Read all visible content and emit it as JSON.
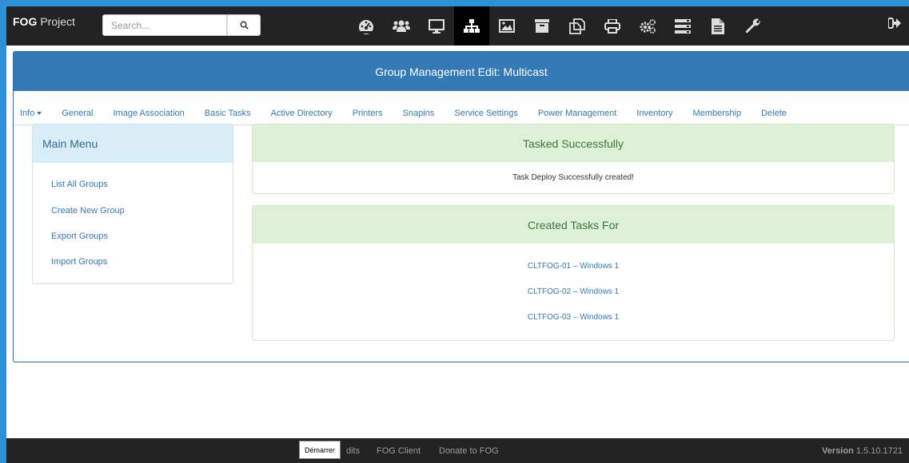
{
  "brand": {
    "bold": "FOG",
    "light": "Project"
  },
  "search": {
    "placeholder": "Search..."
  },
  "nav_icons": [
    "dashboard-icon",
    "users-icon",
    "monitor-icon",
    "sitemap-icon",
    "image-icon",
    "archive-icon",
    "clone-icon",
    "printer-icon",
    "cogs-icon",
    "server-icon",
    "report-icon",
    "wrench-icon"
  ],
  "panel": {
    "title": "Group Management Edit: Multicast"
  },
  "tabs": [
    "Info",
    "General",
    "Image Association",
    "Basic Tasks",
    "Active Directory",
    "Printers",
    "Snapins",
    "Service Settings",
    "Power Management",
    "Inventory",
    "Membership",
    "Delete"
  ],
  "sidebar": {
    "title": "Main Menu",
    "items": [
      "List All Groups",
      "Create New Group",
      "Export Groups",
      "Import Groups"
    ]
  },
  "tasked": {
    "title": "Tasked Successfully",
    "message": "Task Deploy Successfully created!"
  },
  "created": {
    "title": "Created Tasks For",
    "hosts": [
      "CLTFOG-01 – Windows 1",
      "CLTFOG-02 – Windows 1",
      "CLTFOG-03 – Windows 1"
    ]
  },
  "footer": {
    "credits_fragment": "dits",
    "fog_client": "FOG Client",
    "donate": "Donate to FOG",
    "version_label": "Version",
    "version_value": "1.5.10.1721"
  },
  "tooltip": {
    "label": "Démarrer"
  },
  "colors": {
    "navbar": "#222222",
    "primary": "#337ab7",
    "success_bg": "#dff0d8",
    "success_text": "#3c763d",
    "info_bg": "#d9edf7",
    "info_text": "#31708f",
    "frame": "#2b90d9"
  }
}
